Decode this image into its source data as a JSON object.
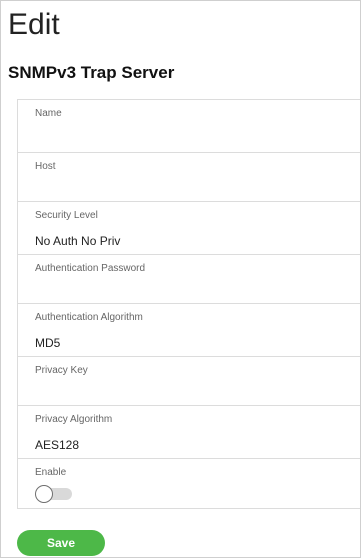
{
  "page": {
    "title": "Edit",
    "section_title": "SNMPv3 Trap Server"
  },
  "form": {
    "fields": [
      {
        "label": "Name",
        "value": ""
      },
      {
        "label": "Host",
        "value": ""
      },
      {
        "label": "Security Level",
        "value": "No Auth No Priv"
      },
      {
        "label": "Authentication Password",
        "value": ""
      },
      {
        "label": "Authentication Algorithm",
        "value": "MD5"
      },
      {
        "label": "Privacy Key",
        "value": ""
      },
      {
        "label": "Privacy Algorithm",
        "value": "AES128"
      }
    ],
    "enable": {
      "label": "Enable",
      "checked": false
    }
  },
  "actions": {
    "save_label": "Save"
  },
  "colors": {
    "accent": "#4db848",
    "toggle_off": "#d9d9d9"
  }
}
